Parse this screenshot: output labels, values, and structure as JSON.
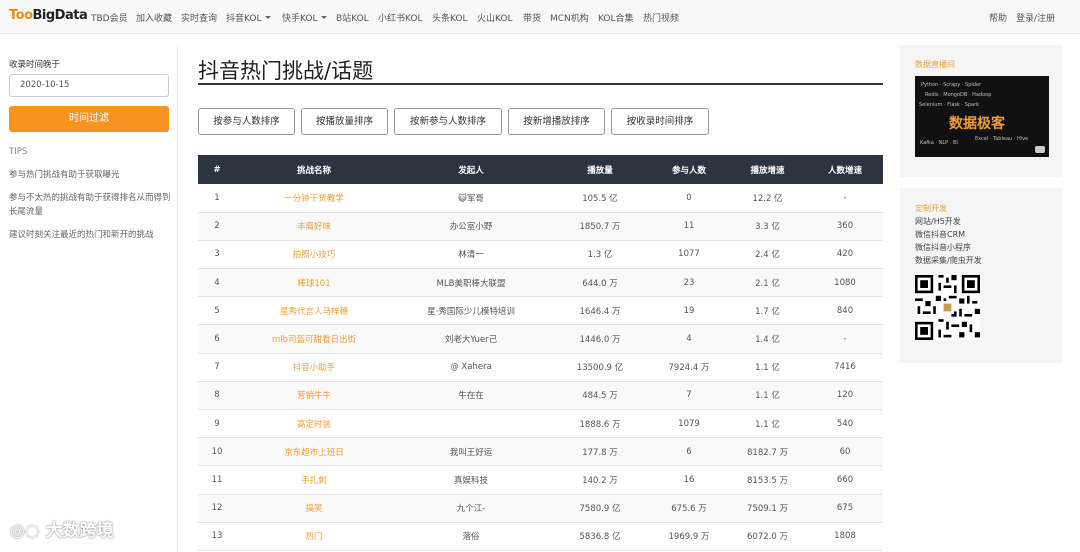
{
  "brand": {
    "logo_too": "Too",
    "logo_big": "BigData"
  },
  "nav": [
    "TBD会员",
    "加入收藏",
    "实时查询",
    "抖音KOL",
    "快手KOL",
    "B站KOL",
    "小红书KOL",
    "头条KOL",
    "火山KOL",
    "带货",
    "MCN机构",
    "KOL合集",
    "热门视频"
  ],
  "nav_right": {
    "help": "帮助",
    "login": "登录/注册"
  },
  "sidebar": {
    "label": "收录时间晚于",
    "date_value": "2020-10-15",
    "filter_button": "时间过滤",
    "tips_title": "TIPS",
    "tips": [
      "参与热门挑战有助于获取曝光",
      "参与不太热的挑战有助于获得排名从而得到长尾流量",
      "建议时刻关注最近的热门和新开的挑战"
    ]
  },
  "main": {
    "title": "抖音热门挑战/话题",
    "sort_buttons": [
      "按参与人数排序",
      "按播放量排序",
      "按新参与人数排序",
      "按新增播放排序",
      "按收录时间排序"
    ]
  },
  "table": {
    "headers": [
      "#",
      "挑战名称",
      "发起人",
      "播放量",
      "参与人数",
      "播放增速",
      "人数增速"
    ],
    "rows": [
      [
        "1",
        "一分钟干货教学",
        "😺军哥",
        "105.5 亿",
        "0",
        "12.2 亿",
        "-"
      ],
      [
        "2",
        "丰裔好味",
        "办公室小野",
        "1850.7 万",
        "11",
        "3.3 亿",
        "360"
      ],
      [
        "3",
        "拍照小技巧",
        "林清一",
        "1.3 亿",
        "1077",
        "2.4 亿",
        "420"
      ],
      [
        "4",
        "棒球101",
        "MLB美职棒大联盟",
        "644.0 万",
        "23",
        "2.1 亿",
        "1080"
      ],
      [
        "5",
        "星秀代言人马梓穗",
        "星·秀国际少儿模特培训",
        "1646.4 万",
        "19",
        "1.7 亿",
        "840"
      ],
      [
        "6",
        "mlb司盔可甜看日出街",
        "刘老大Yuer己",
        "1446.0 万",
        "4",
        "1.4 亿",
        "-"
      ],
      [
        "7",
        "抖音小助手",
        "@ Xahera",
        "13500.9 亿",
        "7924.4 万",
        "1.1 亿",
        "7416"
      ],
      [
        "8",
        "营销牛牛",
        "牛在在",
        "484.5 万",
        "7",
        "1.1 亿",
        "120"
      ],
      [
        "9",
        "高定时装",
        "",
        "1888.6 万",
        "1079",
        "1.1 亿",
        "540"
      ],
      [
        "10",
        "京东超市上班日",
        "我叫王好运",
        "177.8 万",
        "6",
        "8182.7 万",
        "60"
      ],
      [
        "11",
        "手扎刺",
        "真娱科技",
        "140.2 万",
        "16",
        "8153.5 万",
        "660"
      ],
      [
        "12",
        "搞笑",
        "九个江-",
        "7580.9 亿",
        "675.6 万",
        "7509.1 万",
        "675"
      ],
      [
        "13",
        "热门",
        "落俗",
        "5836.8 亿",
        "1969.9 万",
        "6072.0 万",
        "1808"
      ]
    ]
  },
  "right": {
    "card1_title": "数据直播间",
    "video_text": "数据极客",
    "card2_title": "定制开发",
    "services": [
      "网站/H5开发",
      "微信抖音CRM",
      "微信抖音小程序",
      "数据采集/爬虫开发"
    ]
  },
  "watermark": "大数跨境",
  "colors": {
    "accent": "#f7931e",
    "header_dark": "#2c3440",
    "link_orange": "#f39c35"
  }
}
